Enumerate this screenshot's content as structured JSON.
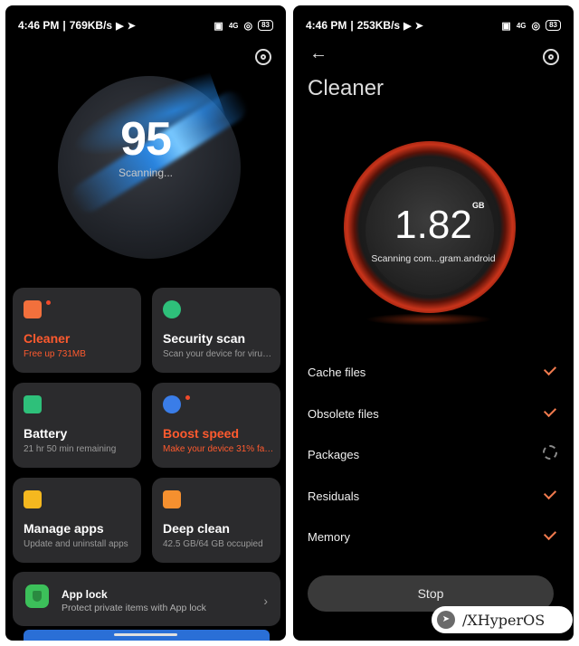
{
  "left": {
    "status": {
      "time": "4:46 PM",
      "speed": "769KB/s",
      "network": "4G",
      "battery": "83"
    },
    "scanner": {
      "score": "95",
      "status": "Scanning..."
    },
    "cards": [
      {
        "title": "Cleaner",
        "subtitle": "Free up 731MB",
        "highlight": true,
        "icon_color": "#f2703c",
        "badge": true
      },
      {
        "title": "Security scan",
        "subtitle": "Scan your device for viruses",
        "highlight": false,
        "icon_color": "#2ec07a",
        "badge": false
      },
      {
        "title": "Battery",
        "subtitle": "21 hr 50 min  remaining",
        "highlight": false,
        "icon_color": "#2ec07a",
        "badge": false
      },
      {
        "title": "Boost speed",
        "subtitle": "Make your device 31% faster",
        "highlight": true,
        "icon_color": "#3a7de8",
        "badge": true
      },
      {
        "title": "Manage apps",
        "subtitle": "Update and uninstall apps",
        "highlight": false,
        "icon_color": "#f5b81f",
        "badge": false
      },
      {
        "title": "Deep clean",
        "subtitle": "42.5 GB/64 GB occupied",
        "highlight": false,
        "icon_color": "#f5902f",
        "badge": false
      }
    ],
    "app_lock": {
      "title": "App lock",
      "subtitle": "Protect private items with App lock"
    }
  },
  "right": {
    "status": {
      "time": "4:46 PM",
      "speed": "253KB/s",
      "network": "4G",
      "battery": "83"
    },
    "title": "Cleaner",
    "size": "1.82",
    "unit": "GB",
    "scanning": "Scanning com...gram.android",
    "items": [
      {
        "label": "Cache files",
        "state": "done"
      },
      {
        "label": "Obsolete files",
        "state": "done"
      },
      {
        "label": "Packages",
        "state": "scanning"
      },
      {
        "label": "Residuals",
        "state": "done"
      },
      {
        "label": "Memory",
        "state": "done"
      }
    ],
    "stop_label": "Stop"
  },
  "watermark": "/XHyperOS"
}
